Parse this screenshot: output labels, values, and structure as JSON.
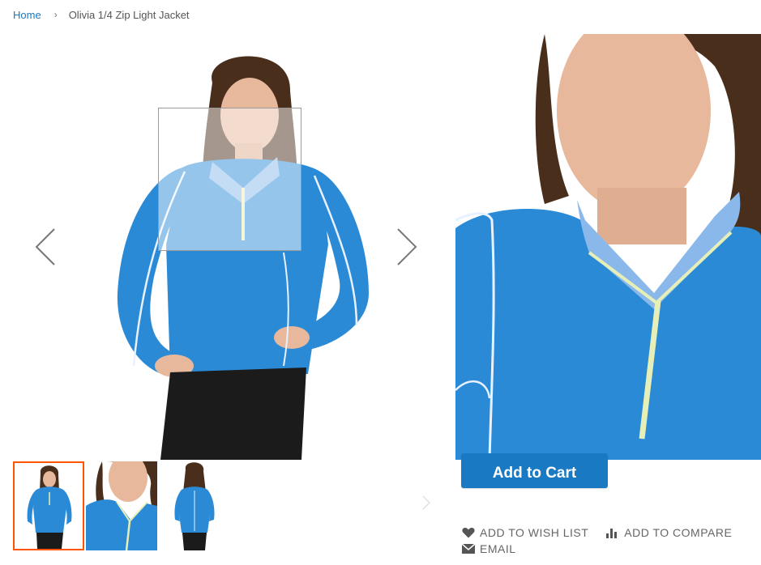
{
  "breadcrumb": {
    "home": "Home",
    "separator": "›",
    "current": "Olivia 1/4 Zip Light Jacket"
  },
  "gallery": {
    "prev_icon": "chevron-left-icon",
    "next_icon": "chevron-right-icon",
    "thumbnails": [
      {
        "view": "front-full",
        "active": true
      },
      {
        "view": "front-closeup",
        "active": false
      },
      {
        "view": "back-full",
        "active": false
      }
    ]
  },
  "product": {
    "add_to_cart_label": "Add to Cart"
  },
  "actions": {
    "wishlist_label": "ADD TO WISH LIST",
    "compare_label": "ADD TO COMPARE",
    "email_label": "EMAIL"
  },
  "colors": {
    "accent": "#1979c3",
    "thumb_active_border": "#ff5501",
    "jacket": "#2b8ad6",
    "pants": "#1b1b1b"
  }
}
